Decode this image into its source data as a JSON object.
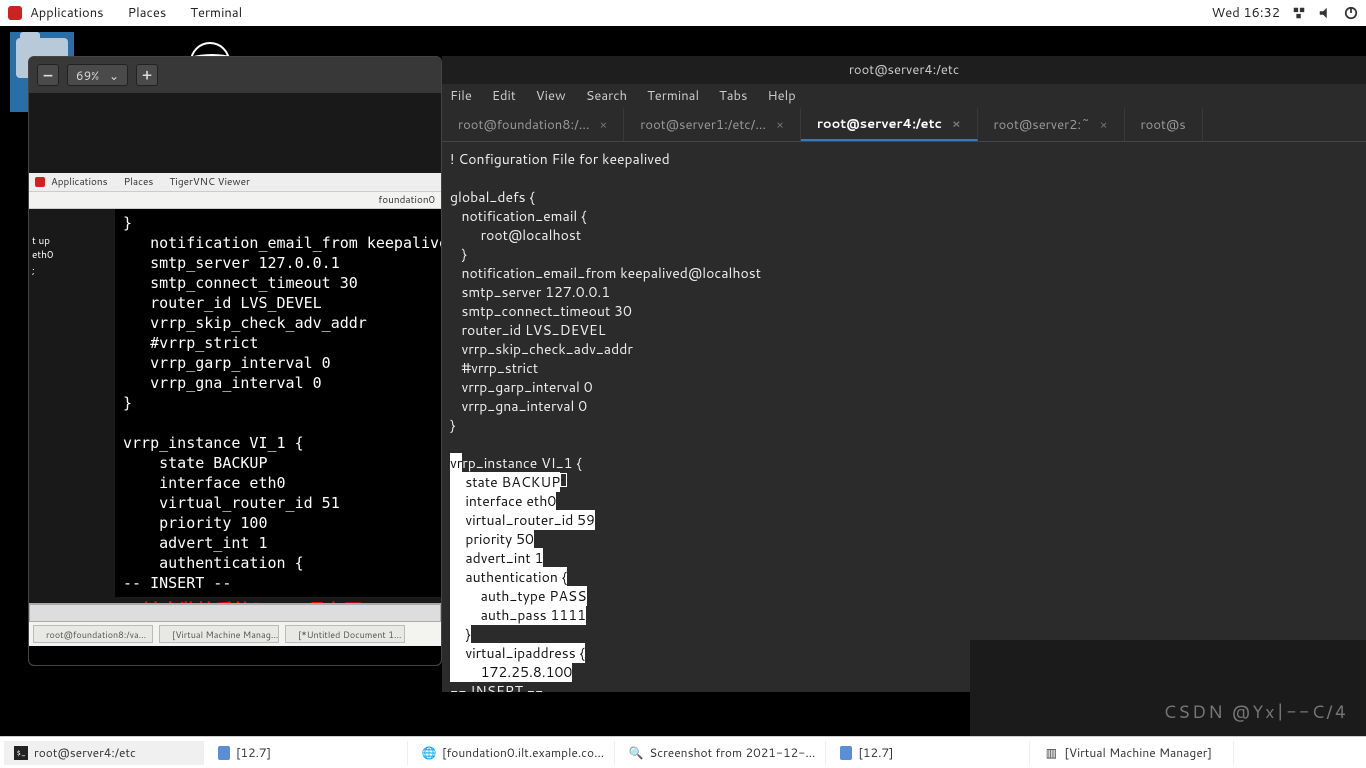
{
  "topbar": {
    "applications": "Applications",
    "places": "Places",
    "terminal": "Terminal",
    "clock": "Wed 16:32"
  },
  "vnc": {
    "zoom": "69%",
    "inner_bar": {
      "applications": "Applications",
      "places": "Places",
      "viewer": "TigerVNC Viewer"
    },
    "inner_sub": "foundation0",
    "side": [
      "t up eth0",
      ";"
    ],
    "code": "}\n   notification_email_from keepalive\n   smtp_server 127.0.0.1\n   smtp_connect_timeout 30\n   router_id LVS_DEVEL\n   vrrp_skip_check_adv_addr\n   #vrrp_strict\n   vrrp_garp_interval 0\n   vrrp_gna_interval 0\n}\n\nvrrp_instance VI_1 {\n    state BACKUP\n    interface eth0\n    virtual_router_id 51\n    priority 100\n    advert_int 1\n    authentication {\n-- INSERT --",
    "red": "Q：缺少监控系统？LVS具有开",
    "tasks": [
      "root@foundation8:/va…",
      "[Virtual Machine Manag…",
      "[*Untitled Document 1…"
    ]
  },
  "term": {
    "title": "root@server4:/etc",
    "menus": [
      "File",
      "Edit",
      "View",
      "Search",
      "Terminal",
      "Tabs",
      "Help"
    ],
    "tabs": [
      {
        "label": "root@foundation8:/…",
        "active": false
      },
      {
        "label": "root@server1:/etc/…",
        "active": false
      },
      {
        "label": "root@server4:/etc",
        "active": true
      },
      {
        "label": "root@server2:~",
        "active": false
      },
      {
        "label": "root@s",
        "active": false
      }
    ],
    "body_pre": "! Configuration File for keepalived\n\nglobal_defs {\n   notification_email {\n        root@localhost\n   }\n   notification_email_from keepalived@localhost\n   smtp_server 127.0.0.1\n   smtp_connect_timeout 30\n   router_id LVS_DEVEL\n   vrrp_skip_check_adv_addr\n   #vrrp_strict\n   vrrp_garp_interval 0\n   vrrp_gna_interval 0\n}\n\n",
    "body_hl": "vr",
    "body_l1": "rp_instance VI_1 {\n",
    "body_l2": "    state BACKUP",
    "body_post": "\n    interface eth0\n    virtual_router_id 59\n    priority 50\n    advert_int 1\n    authentication {\n        auth_type PASS\n        auth_pass 1111\n    }\n    virtual_ipaddress {\n        172.25.8.100\n",
    "insert": "-- INSERT --"
  },
  "watermark": "CSDN @Yx|--C/4",
  "host": {
    "items": [
      {
        "label": "root@server4:/etc",
        "type": "term"
      },
      {
        "label": "[12.7]",
        "type": "doc"
      },
      {
        "label": "[foundation0.ilt.example.co…",
        "type": "img"
      },
      {
        "label": "Screenshot from 2021-12-…",
        "type": "img"
      },
      {
        "label": "[12.7]",
        "type": "doc"
      },
      {
        "label": "[Virtual Machine Manager]",
        "type": "vmm"
      }
    ]
  }
}
